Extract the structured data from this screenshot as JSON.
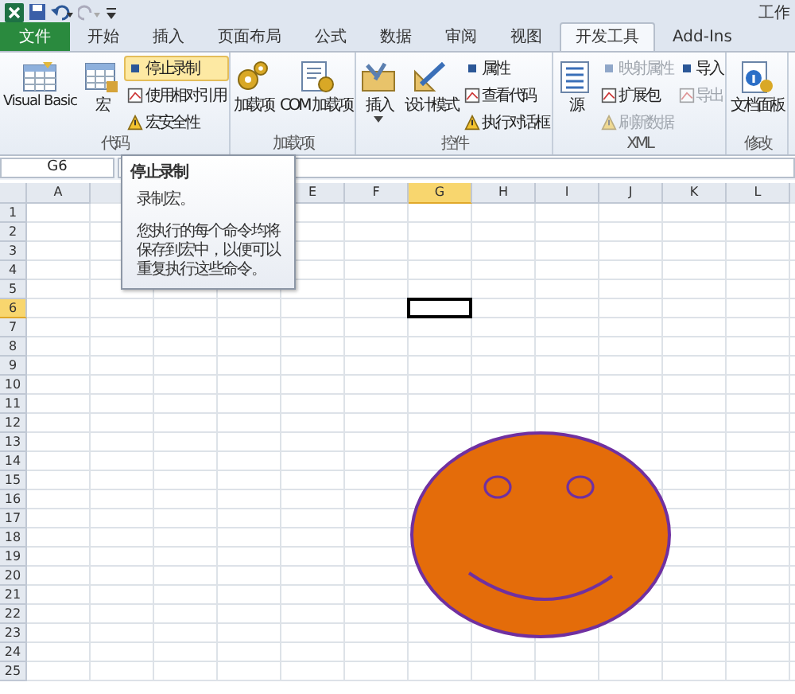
{
  "window": {
    "title": "工作"
  },
  "tabs": [
    {
      "label": "文件",
      "selected": false,
      "kind": "file"
    },
    {
      "label": "开始",
      "selected": false,
      "kind": "tab"
    },
    {
      "label": "插入",
      "selected": false,
      "kind": "tab"
    },
    {
      "label": "页面布局",
      "selected": false,
      "kind": "tab"
    },
    {
      "label": "公式",
      "selected": false,
      "kind": "tab"
    },
    {
      "label": "数据",
      "selected": false,
      "kind": "tab"
    },
    {
      "label": "审阅",
      "selected": false,
      "kind": "tab"
    },
    {
      "label": "视图",
      "selected": false,
      "kind": "tab"
    },
    {
      "label": "开发工具",
      "selected": true,
      "kind": "tab"
    },
    {
      "label": "Add-Ins",
      "selected": false,
      "kind": "tab"
    }
  ],
  "ribbon": {
    "groups": [
      {
        "label": "代码",
        "items": [
          {
            "label": "Visual Basic",
            "kind": "large",
            "highlighted": false,
            "disabled": false
          },
          {
            "label": "宏",
            "kind": "large",
            "highlighted": false,
            "disabled": false
          },
          {
            "label": "停止录制",
            "kind": "small",
            "highlighted": true,
            "disabled": false
          },
          {
            "label": "使用相对引用",
            "kind": "small",
            "highlighted": false,
            "disabled": false
          },
          {
            "label": "宏安全性",
            "kind": "small",
            "highlighted": false,
            "disabled": false
          }
        ]
      },
      {
        "label": "加载项",
        "items": [
          {
            "label": "加载项",
            "kind": "large",
            "highlighted": false,
            "disabled": false
          },
          {
            "label": "COM 加载项",
            "kind": "large",
            "highlighted": false,
            "disabled": false
          }
        ]
      },
      {
        "label": "控件",
        "items": [
          {
            "label": "插入",
            "kind": "large",
            "highlighted": false,
            "disabled": false,
            "dropdown": true
          },
          {
            "label": "设计模式",
            "kind": "large",
            "highlighted": false,
            "disabled": false
          },
          {
            "label": "属性",
            "kind": "small",
            "highlighted": false,
            "disabled": false
          },
          {
            "label": "查看代码",
            "kind": "small",
            "highlighted": false,
            "disabled": false
          },
          {
            "label": "执行对话框",
            "kind": "small",
            "highlighted": false,
            "disabled": false
          }
        ]
      },
      {
        "label": "XML",
        "items": [
          {
            "label": "源",
            "kind": "large",
            "highlighted": false,
            "disabled": false
          },
          {
            "label": "映射属性",
            "kind": "small",
            "highlighted": false,
            "disabled": true
          },
          {
            "label": "扩展包",
            "kind": "small",
            "highlighted": false,
            "disabled": false
          },
          {
            "label": "刷新数据",
            "kind": "small",
            "highlighted": false,
            "disabled": true
          },
          {
            "label": "导入",
            "kind": "small",
            "highlighted": false,
            "disabled": false
          },
          {
            "label": "导出",
            "kind": "small",
            "highlighted": false,
            "disabled": true
          }
        ]
      },
      {
        "label": "修改",
        "items": [
          {
            "label": "文档面板",
            "kind": "large",
            "highlighted": false,
            "disabled": false
          }
        ]
      }
    ]
  },
  "name_box": "G6",
  "tooltip": {
    "title": "停止录制",
    "paragraphs": [
      "录制宏。",
      "您执行的每个命令均将保存到宏中，以便可以重复执行这些命令。"
    ]
  },
  "sheet": {
    "columns": [
      {
        "label": "A",
        "selected": false
      },
      {},
      {},
      {},
      {
        "label": "E",
        "selected": false
      },
      {
        "label": "F",
        "selected": false
      },
      {
        "label": "G",
        "selected": true
      },
      {
        "label": "H",
        "selected": false
      },
      {
        "label": "I",
        "selected": false
      },
      {
        "label": "J",
        "selected": false
      },
      {
        "label": "K",
        "selected": false
      },
      {
        "label": "L",
        "selected": false
      }
    ],
    "rows": [
      {
        "label": "1",
        "selected": false
      },
      {
        "label": "2",
        "selected": false
      },
      {
        "label": "3",
        "selected": false
      },
      {
        "label": "4",
        "selected": false
      },
      {
        "label": "5",
        "selected": false
      },
      {
        "label": "6",
        "selected": true
      },
      {
        "label": "7",
        "selected": false
      },
      {
        "label": "8",
        "selected": false
      },
      {
        "label": "9",
        "selected": false
      },
      {
        "label": "10",
        "selected": false
      },
      {
        "label": "11",
        "selected": false
      },
      {
        "label": "12",
        "selected": false
      },
      {
        "label": "13",
        "selected": false
      },
      {
        "label": "14",
        "selected": false
      },
      {
        "label": "15",
        "selected": false
      },
      {
        "label": "16",
        "selected": false
      },
      {
        "label": "17",
        "selected": false
      },
      {
        "label": "18",
        "selected": false
      },
      {
        "label": "19",
        "selected": false
      },
      {
        "label": "20",
        "selected": false
      },
      {
        "label": "21",
        "selected": false
      },
      {
        "label": "22",
        "selected": false
      },
      {
        "label": "23",
        "selected": false
      },
      {
        "label": "24",
        "selected": false
      },
      {
        "label": "25",
        "selected": false
      }
    ]
  }
}
